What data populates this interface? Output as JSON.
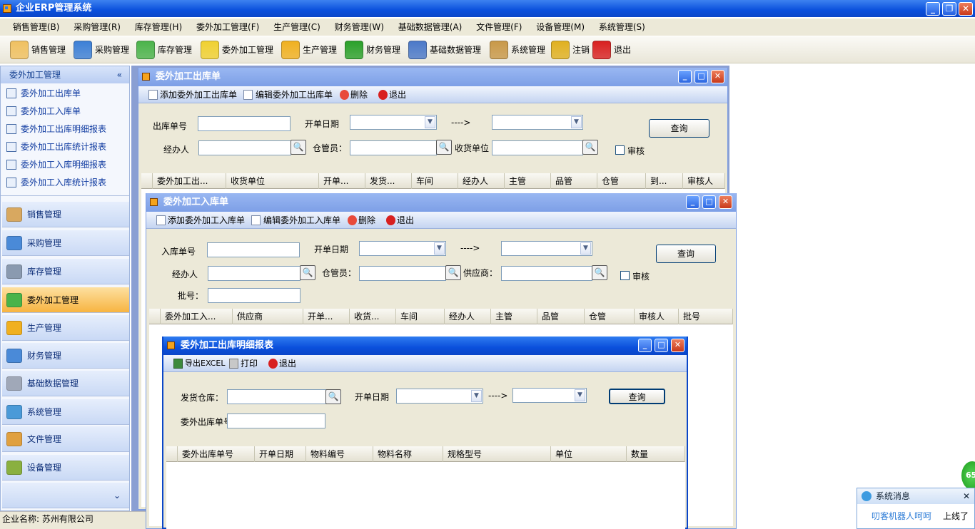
{
  "app": {
    "title": "企业ERP管理系统"
  },
  "menu": [
    "销售管理(B)",
    "采购管理(R)",
    "库存管理(H)",
    "委外加工管理(F)",
    "生产管理(C)",
    "财务管理(W)",
    "基础数据管理(A)",
    "文件管理(F)",
    "设备管理(M)",
    "系统管理(S)"
  ],
  "toolbar": [
    {
      "label": "销售管理",
      "icon": "pencil-paper-icon",
      "color": "#f0c060"
    },
    {
      "label": "采购管理",
      "icon": "basket-icon",
      "color": "#3c7fd6"
    },
    {
      "label": "库存管理",
      "icon": "house-icon",
      "color": "#4ab34a"
    },
    {
      "label": "委外加工管理",
      "icon": "folder-icon",
      "color": "#f0d030"
    },
    {
      "label": "生产管理",
      "icon": "gear-icon",
      "color": "#f0b020"
    },
    {
      "label": "财务管理",
      "icon": "dollar-icon",
      "color": "#2aa02a"
    },
    {
      "label": "基础数据管理",
      "icon": "calendar-icon",
      "color": "#4a78c8"
    },
    {
      "label": "系统管理",
      "icon": "tools-icon",
      "color": "#c89848"
    },
    {
      "label": "注销",
      "icon": "key-icon",
      "color": "#e0b020"
    },
    {
      "label": "退出",
      "icon": "close-circle-icon",
      "color": "#d82020"
    }
  ],
  "left_panel": {
    "header": "委外加工管理",
    "collapse_glyph": "«",
    "items": [
      "委外加工出库单",
      "委外加工入库单",
      "委外加工出库明细报表",
      "委外加工出库统计报表",
      "委外加工入库明细报表",
      "委外加工入库统计报表"
    ],
    "nav": [
      {
        "label": "销售管理",
        "color": "#d8a860"
      },
      {
        "label": "采购管理",
        "color": "#4a8ad8"
      },
      {
        "label": "库存管理",
        "color": "#8a9ab0"
      },
      {
        "label": "委外加工管理",
        "color": "#4ab34a"
      },
      {
        "label": "生产管理",
        "color": "#f0b020"
      },
      {
        "label": "财务管理",
        "color": "#4a8ad8"
      },
      {
        "label": "基础数据管理",
        "color": "#a0a8b8"
      },
      {
        "label": "系统管理",
        "color": "#4a9ad8"
      },
      {
        "label": "文件管理",
        "color": "#e0a040"
      },
      {
        "label": "设备管理",
        "color": "#8ab040"
      }
    ],
    "expand_glyph": "⌄",
    "active_index": 3
  },
  "status": {
    "company": "企业名称: 苏州有限公司"
  },
  "win1": {
    "title": "委外加工出库单",
    "tools": [
      "添加委外加工出库单",
      "编辑委外加工出库单",
      "删除",
      "退出"
    ],
    "labels": {
      "no": "出库单号",
      "date": "开单日期",
      "arrow": "---->",
      "handler": "经办人",
      "keeper": "仓管员：",
      "unit": "收货单位",
      "audit": "审核"
    },
    "query": "查询",
    "columns": [
      "委外加工出...",
      "收货单位",
      "开单...",
      "发货...",
      "车间",
      "经办人",
      "主管",
      "品管",
      "仓管",
      "到...",
      "审核人"
    ]
  },
  "win2": {
    "title": "委外加工入库单",
    "tools": [
      "添加委外加工入库单",
      "编辑委外加工入库单",
      "删除",
      "退出"
    ],
    "labels": {
      "no": "入库单号",
      "date": "开单日期",
      "arrow": "---->",
      "handler": "经办人",
      "keeper": "仓管员：",
      "supplier": "供应商：",
      "audit": "审核",
      "batch": "批号："
    },
    "query": "查询",
    "columns": [
      "委外加工入...",
      "供应商",
      "开单...",
      "收货...",
      "车间",
      "经办人",
      "主管",
      "品管",
      "仓管",
      "审核人",
      "批号"
    ]
  },
  "win3": {
    "title": "委外加工出库明细报表",
    "tools": [
      "导出EXCEL",
      "打印",
      "退出"
    ],
    "labels": {
      "wh": "发货仓库：",
      "date": "开单日期",
      "arrow": "---->",
      "no": "委外出库单号"
    },
    "query": "查询",
    "columns": [
      "委外出库单号",
      "开单日期",
      "物料编号",
      "物料名称",
      "规格型号",
      "单位",
      "数量"
    ]
  },
  "popup": {
    "title": "系统消息",
    "user": "叨客机器人呵呵",
    "status": "上线了",
    "close": "✕"
  },
  "bubble": {
    "text": "65"
  },
  "window_buttons": {
    "min": "_",
    "max": "□",
    "restore": "❐",
    "close": "✕"
  },
  "search_glyph": "🔍",
  "dropdown_glyph": "▼"
}
